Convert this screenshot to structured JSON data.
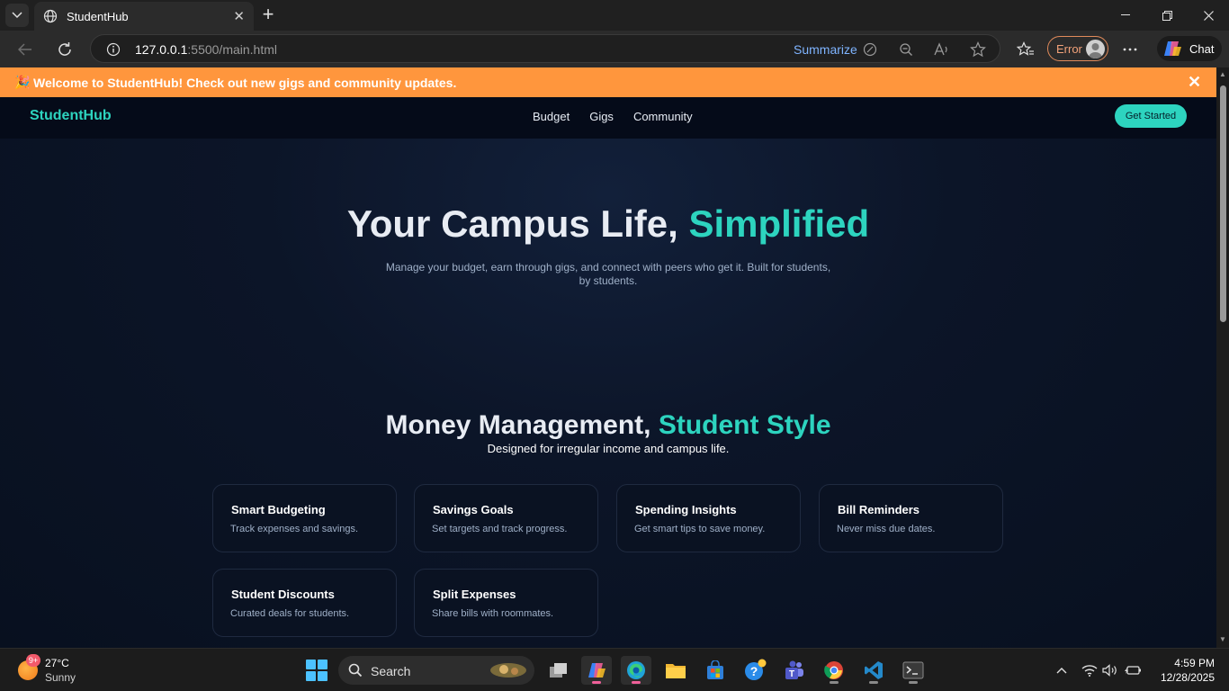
{
  "browser": {
    "tab_title": "StudentHub",
    "url_host": "127.0.0.1",
    "url_rest": ":5500/main.html",
    "summarize_label": "Summarize",
    "profile_status": "Error",
    "chat_label": "Chat"
  },
  "page": {
    "banner": {
      "emoji": "🎉",
      "text": "Welcome to StudentHub! Check out new gigs and community updates.",
      "close": "✕"
    },
    "nav": {
      "brand": "StudentHub",
      "links": [
        "Budget",
        "Gigs",
        "Community"
      ],
      "cta": "Get Started"
    },
    "hero": {
      "title_main": "Your Campus Life, ",
      "title_accent": "Simplified",
      "subtitle": "Manage your budget, earn through gigs, and connect with peers who get it. Built for students, by students."
    },
    "money_section": {
      "title_main": "Money Management, ",
      "title_accent": "Student Style",
      "subtitle": "Designed for irregular income and campus life.",
      "cards": [
        {
          "title": "Smart Budgeting",
          "desc": "Track expenses and savings."
        },
        {
          "title": "Savings Goals",
          "desc": "Set targets and track progress."
        },
        {
          "title": "Spending Insights",
          "desc": "Get smart tips to save money."
        },
        {
          "title": "Bill Reminders",
          "desc": "Never miss due dates."
        },
        {
          "title": "Student Discounts",
          "desc": "Curated deals for students."
        },
        {
          "title": "Split Expenses",
          "desc": "Share bills with roommates."
        }
      ]
    }
  },
  "taskbar": {
    "weather_badge": "9+",
    "temperature": "27°C",
    "condition": "Sunny",
    "search_label": "Search",
    "time": "4:59 PM",
    "date": "12/28/2025"
  },
  "colors": {
    "accent": "#2dd4bf",
    "banner": "#ff963d",
    "background": "#08101f"
  }
}
